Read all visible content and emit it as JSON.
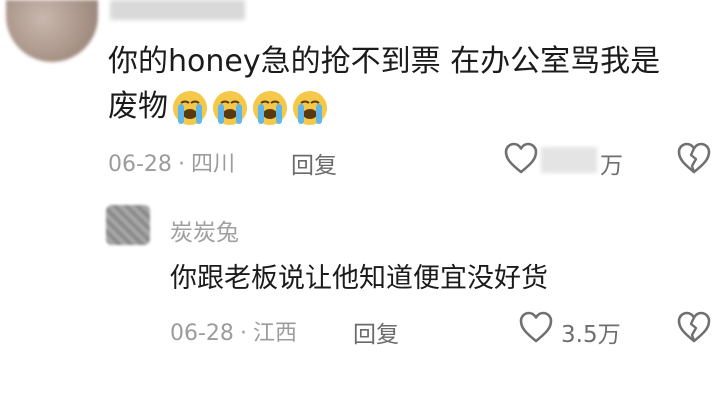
{
  "comment": {
    "text_line1": "你的honey急的抢不到票  在办公室骂我是",
    "text_line2": "废物",
    "emoji_count_icon": "loudly-crying-face",
    "date": "06-28",
    "location": "四川",
    "reply_label": "回复",
    "like_count_unit": "万"
  },
  "reply": {
    "username": "炭炭兔",
    "text": "你跟老板说让他知道便宜没好货",
    "date": "06-28",
    "location": "江西",
    "reply_label": "回复",
    "like_count": "3.5万"
  },
  "colors": {
    "meta": "#9c9c9c",
    "text": "#1b1b1b",
    "emoji_face": "#f6c84a",
    "tears": "#5fb6e8"
  }
}
